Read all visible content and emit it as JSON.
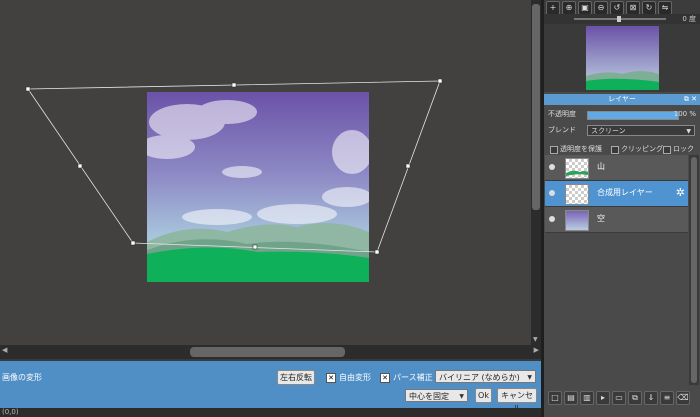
{
  "transform": {
    "title": "画像の変形",
    "flip_label": "左右反転",
    "free_transform_label": "自由変形",
    "free_transform_checked": true,
    "perspective_label": "パース補正",
    "perspective_checked": true,
    "interpolation_value": "バイリニア (なめらか)",
    "anchor_value": "中心を固定",
    "ok_label": "Ok",
    "cancel_label": "キャンセル"
  },
  "statusbar": {
    "text": "(0,0)"
  },
  "navigator": {
    "rotation_value": "0 度"
  },
  "layers_panel": {
    "title": "レイヤー",
    "opacity_label": "不透明度",
    "opacity_value": "100 %",
    "opacity_fraction": 1.0,
    "blend_label": "ブレンド",
    "blend_value": "スクリーン",
    "protect_alpha_label": "透明度を保護",
    "clipping_label": "クリッピング",
    "lock_label": "ロック",
    "layers": [
      {
        "name": "山",
        "visible": true,
        "selected": false
      },
      {
        "name": "合成用レイヤー",
        "visible": true,
        "selected": true
      },
      {
        "name": "空",
        "visible": true,
        "selected": false
      }
    ]
  },
  "colors": {
    "accent_blue": "#4f8fc6",
    "selected_layer": "#4f94d1",
    "sky_top": "#6b52a8",
    "grass": "#0fb05a"
  }
}
